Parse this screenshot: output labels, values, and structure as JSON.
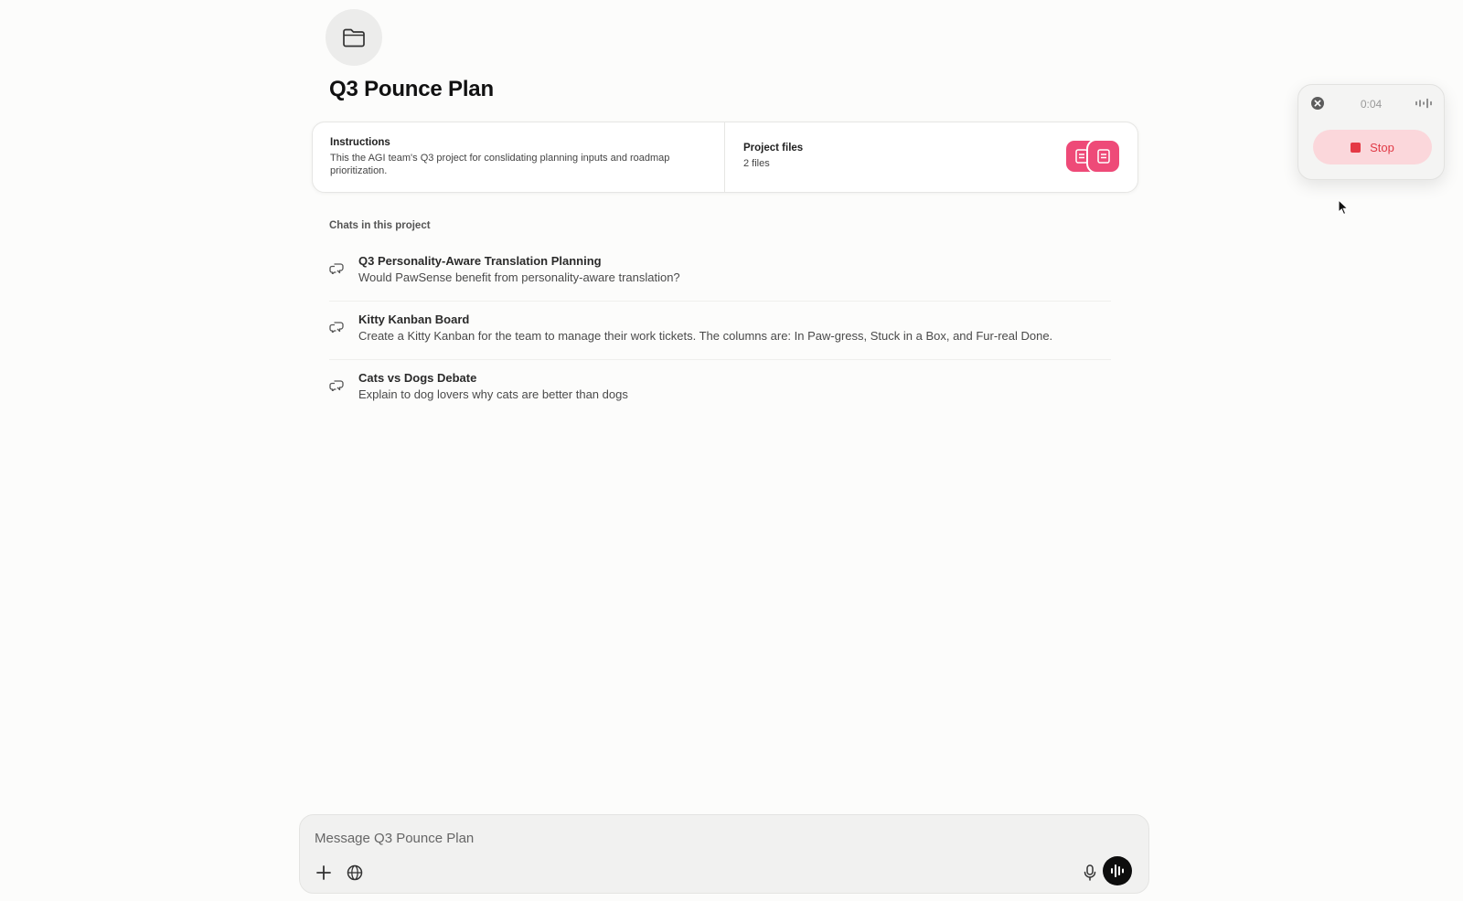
{
  "project": {
    "icon": "folder-icon",
    "title": "Q3 Pounce Plan"
  },
  "instructions": {
    "heading": "Instructions",
    "text": "This the AGI team's Q3 project for conslidating planning inputs and roadmap prioritization."
  },
  "project_files": {
    "heading": "Project files",
    "count_label": "2 files",
    "thumb_color": "#ee4a78"
  },
  "chats": {
    "section_label": "Chats in this project",
    "items": [
      {
        "title": "Q3 Personality-Aware Translation Planning",
        "subtitle": "Would PawSense benefit from personality-aware translation?"
      },
      {
        "title": "Kitty Kanban Board",
        "subtitle": "Create a Kitty Kanban for the team to manage their work tickets. The columns are: In Paw-gress, Stuck in a Box, and Fur-real Done."
      },
      {
        "title": "Cats vs Dogs Debate",
        "subtitle": "Explain to dog lovers why cats are better than dogs"
      }
    ]
  },
  "composer": {
    "placeholder": "Message Q3 Pounce Plan",
    "value": ""
  },
  "recorder": {
    "timer": "0:04",
    "stop_label": "Stop",
    "stop_color": "#e53945"
  }
}
